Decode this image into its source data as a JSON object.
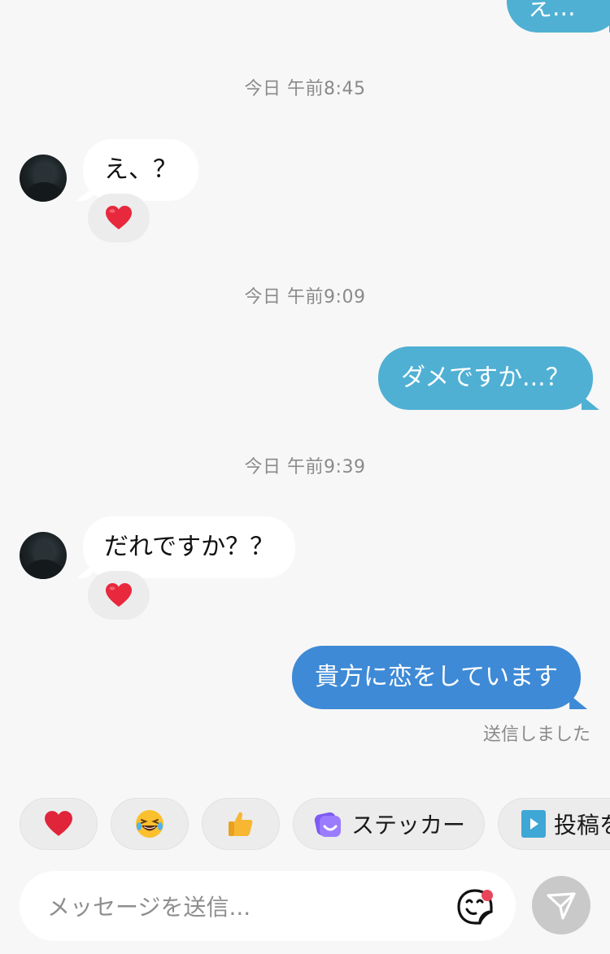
{
  "messages": {
    "top_partial": "え...",
    "ts1": "今日 午前8:45",
    "in1": "え、？",
    "ts2": "今日 午前9:09",
    "out1": "ダメですか...？",
    "ts3": "今日 午前9:39",
    "in2": "だれですか？？",
    "out2": "貴方に恋をしています",
    "status": "送信しました"
  },
  "quick_replies": {
    "sticker_label": "ステッカー",
    "post_label": "投稿を"
  },
  "composer": {
    "placeholder": "メッセージを送信..."
  },
  "icons": {
    "reaction": "heart-icon",
    "chip1": "heart-icon",
    "chip2": "laughing-emoji-icon",
    "chip3": "thumbs-up-icon",
    "chip4": "sticker-icon",
    "chip5": "play-post-icon",
    "sticker": "sticker-face-icon",
    "send": "send-arrow-icon"
  },
  "colors": {
    "outgoing_light": "#4fb0d4",
    "outgoing_deep": "#3e8ad6",
    "incoming": "#ffffff",
    "background": "#f7f7f7",
    "notification_dot": "#e8455a"
  }
}
